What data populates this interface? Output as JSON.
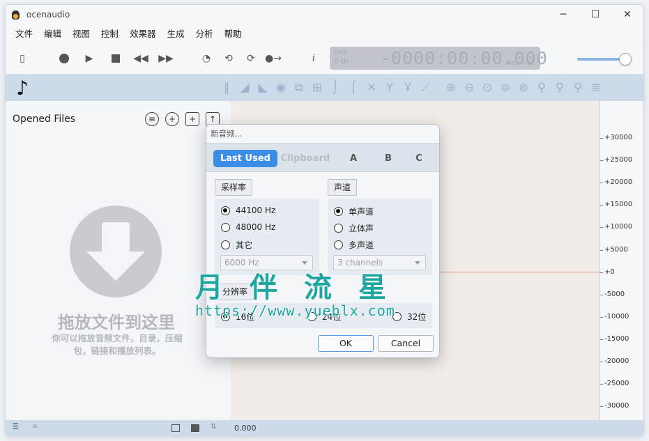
{
  "window": {
    "title": "ocenaudio"
  },
  "menu": [
    "文件",
    "编辑",
    "视图",
    "控制",
    "效果器",
    "生成",
    "分析",
    "帮助"
  ],
  "lcd": {
    "freq": "0Hz",
    "channels": "0 ch",
    "time": "-0000:00:00.000",
    "unit": "decimal"
  },
  "left_panel": {
    "title": "Opened Files",
    "drop_title": "拖放文件到这里",
    "drop_subtitle": "你可以拖放音频文件，目录，压缩包，链接和播放列表。"
  },
  "ruler": [
    "+30000",
    "+25000",
    "+20000",
    "+15000",
    "+10000",
    "+5000",
    "+0",
    "-5000",
    "-10000",
    "-15000",
    "-20000",
    "-25000",
    "-30000"
  ],
  "status": {
    "time": "0.000"
  },
  "dialog": {
    "title": "新音频...",
    "tabs": [
      "Last Used",
      "Clipboard",
      "A",
      "B",
      "C"
    ],
    "sample_rate": {
      "label": "采样率",
      "options": [
        "44100 Hz",
        "48000 Hz",
        "其它"
      ],
      "selected": 0,
      "custom_value": "6000 Hz"
    },
    "channels": {
      "label": "声道",
      "options": [
        "单声道",
        "立体声",
        "多声道"
      ],
      "selected": 0,
      "custom_value": "3 channels"
    },
    "resolution": {
      "label": "分辨率",
      "options": [
        "16位",
        "24位",
        "32位"
      ],
      "selected": 0
    },
    "ok_label": "OK",
    "cancel_label": "Cancel"
  },
  "watermark": {
    "text": "月伴流星",
    "url": "https://www.yueblx.com"
  },
  "colors": {
    "accent": "#3b8de6",
    "panel": "#ccdaea",
    "wave_bg": "#f2ece9"
  }
}
